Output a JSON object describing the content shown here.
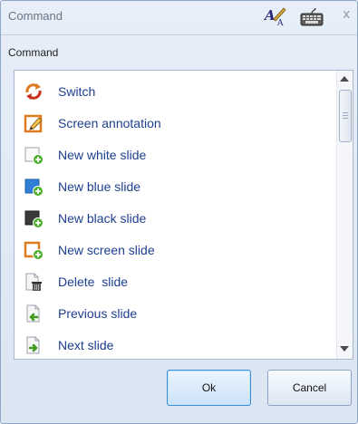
{
  "window": {
    "title": "Command",
    "close_glyph": "x"
  },
  "section_label": "Command",
  "commands": [
    {
      "label": "Switch",
      "icon": "switch-arrows-icon"
    },
    {
      "label": "Screen annotation",
      "icon": "annotation-pencil-icon"
    },
    {
      "label": "New white slide",
      "icon": "new-white-slide-icon"
    },
    {
      "label": "New blue slide",
      "icon": "new-blue-slide-icon"
    },
    {
      "label": "New black slide",
      "icon": "new-black-slide-icon"
    },
    {
      "label": "New screen slide",
      "icon": "new-screen-slide-icon"
    },
    {
      "label": "Delete  slide",
      "icon": "delete-slide-icon"
    },
    {
      "label": "Previous slide",
      "icon": "previous-slide-icon"
    },
    {
      "label": "Next slide",
      "icon": "next-slide-icon"
    }
  ],
  "buttons": {
    "ok": "Ok",
    "cancel": "Cancel"
  },
  "colors": {
    "accent_orange": "#e07a1f",
    "slide_blue": "#2f7fd6",
    "slide_black": "#3a3a3a",
    "plus_green": "#4cae2b",
    "label_blue": "#1d3f8f"
  }
}
